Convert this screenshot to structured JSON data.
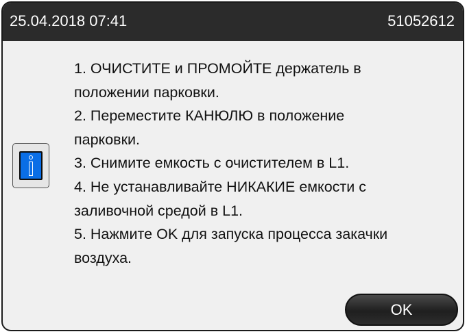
{
  "titlebar": {
    "datetime": "25.04.2018 07:41",
    "device_id": "51052612"
  },
  "message": {
    "lines": [
      "1. ОЧИСТИТЕ и ПРОМОЙТЕ держатель в",
      "положении парковки.",
      "2. Переместите КАНЮЛЮ в положение",
      "парковки.",
      "3. Снимите емкость с очистителем в L1.",
      "4. Не устанавливайте НИКАКИЕ емкости с",
      "заливочной средой в L1.",
      "5. Нажмите OK для запуска процесса закачки",
      "воздуха."
    ]
  },
  "icon": {
    "name": "info-icon",
    "color": "#0a6ee6"
  },
  "buttons": {
    "ok_label": "OK"
  },
  "colors": {
    "titlebar_bg": "#2b2b2b",
    "dialog_bg": "#f0f0f0"
  }
}
